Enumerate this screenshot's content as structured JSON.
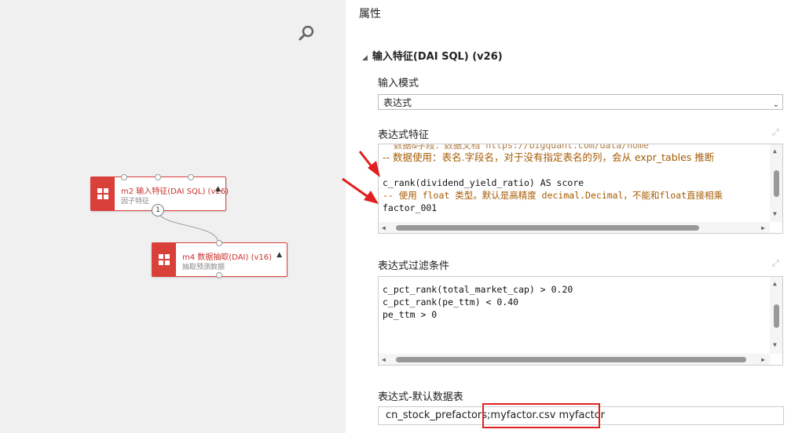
{
  "canvas": {
    "nodes": [
      {
        "title": "m2 输入特征(DAI SQL) (v26)",
        "subtitle": "因子特征"
      },
      {
        "title": "m4 数据抽取(DAI) (v16)",
        "subtitle": "抽取预测数据"
      }
    ],
    "port_number": "1"
  },
  "panel": {
    "title": "属性",
    "section_title": "输入特征(DAI SQL) (v26)",
    "input_mode": {
      "label": "输入模式",
      "value": "表达式"
    },
    "expr_features": {
      "label": "表达式特征",
      "lines": [
        "  数据&字段：数据文档 https://bigquant.com/data/home",
        "-- 数据使用：表名.字段名，对于没有指定表名的列，会从 expr_tables 推断",
        "",
        "c_rank(dividend_yield_ratio) AS score",
        "-- 使用 float 类型。默认是高精度 decimal.Decimal，不能和float直接相乘",
        "factor_001"
      ]
    },
    "expr_filters": {
      "label": "表达式过滤条件",
      "lines": [
        "c_pct_rank(total_market_cap) > 0.20",
        "c_pct_rank(pe_ttm) < 0.40",
        "pe_ttm > 0"
      ]
    },
    "default_tables": {
      "label": "表达式-默认数据表",
      "value": "cn_stock_prefactors;myfactor.csv myfactor"
    }
  },
  "colors": {
    "accent": "#d9403a",
    "annotation": "#e02020"
  }
}
